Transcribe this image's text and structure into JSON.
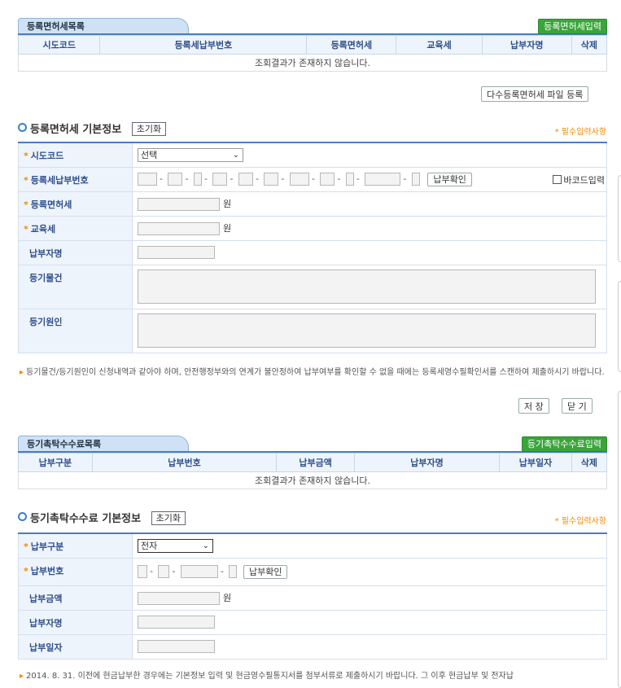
{
  "reg_list": {
    "tab": "등록면허세목록",
    "add_button": "등록면허세입력",
    "columns": [
      "시도코드",
      "등록세납부번호",
      "등록면허세",
      "교육세",
      "납부자명",
      "삭제"
    ],
    "empty_message": "조회결과가 존재하지 않습니다.",
    "bulk_button": "다수등록면허세 파일 등록"
  },
  "reg_info": {
    "title": "등록면허세 기본정보",
    "reset": "초기화",
    "required_note": "* 필수입력사항",
    "required_mark": "*",
    "fields": {
      "sido": "시도코드",
      "payno": "등록세납부번호",
      "amount": "등록면허세",
      "edu": "교육세",
      "payer": "납부자명",
      "item": "등기물건",
      "cause": "등기원인"
    },
    "sido_selected": "선택",
    "pay_check": "납부확인",
    "barcode": "바코드입력",
    "won": "원",
    "notice": "등기물건/등기원인이 신청내역과 같아야 하며, 안전행정부와의 연계가 불안정하여 납부여부를 확인할 수 없을 때에는 등록세영수필확인서를 스캔하여 제출하시기 바랍니다.",
    "save": "저 장",
    "close": "닫 기"
  },
  "fee_list": {
    "tab": "등기촉탁수수료목록",
    "add_button": "등기촉탁수수료입력",
    "columns": [
      "납부구분",
      "납부번호",
      "납부금액",
      "납부자명",
      "납부일자",
      "삭제"
    ],
    "empty_message": "조회결과가 존재하지 않습니다."
  },
  "fee_info": {
    "title": "등기촉탁수수료 기본정보",
    "reset": "초기화",
    "required_note": "* 필수입력사항",
    "fields": {
      "type": "납부구분",
      "payno": "납부번호",
      "amount": "납부금액",
      "payer": "납부자명",
      "date": "납부일자"
    },
    "type_selected": "전자",
    "pay_check": "납부확인",
    "won": "원",
    "notice": "2014. 8. 31. 이전에 현금납부한 경우에는 기본정보 입력 및 현금영수필통지서를 첨부서류로 제출하시기 바랍니다. 그 이후 현금납부 및 전자납"
  }
}
